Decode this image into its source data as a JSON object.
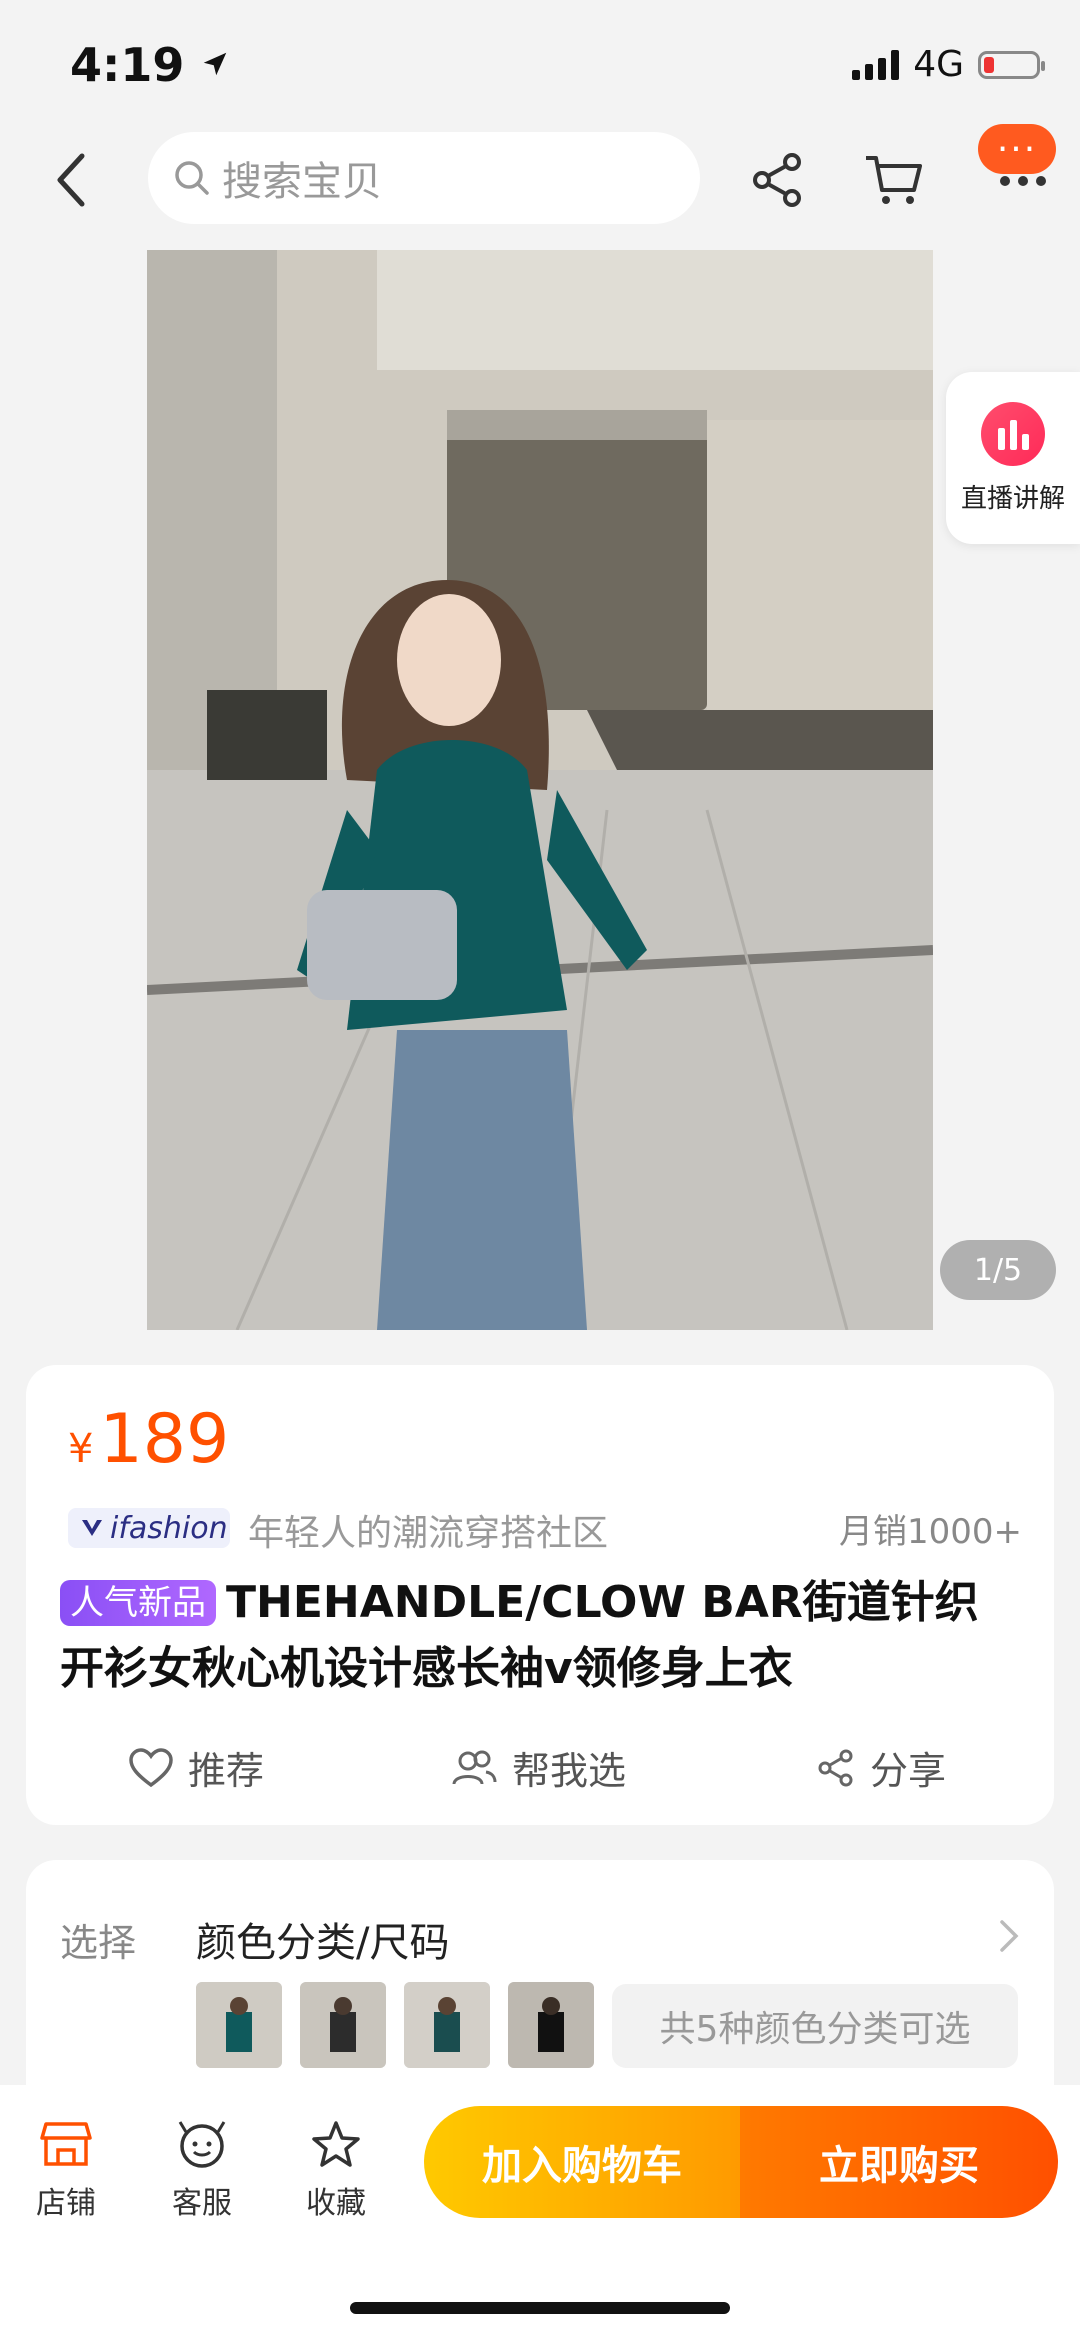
{
  "status_bar": {
    "time": "4:19",
    "network": "4G"
  },
  "nav": {
    "search_placeholder": "搜索宝贝",
    "more_badge": "···"
  },
  "live": {
    "label": "直播讲解"
  },
  "gallery": {
    "page_indicator": "1/5"
  },
  "product": {
    "currency": "¥",
    "price": "189",
    "brand_badge": "ifashion",
    "slogan": "年轻人的潮流穿搭社区",
    "monthly_sales": "月销1000+",
    "tag": "人气新品",
    "title": "THEHANDLE/CLOW BAR街道针织开衫女秋心机设计感长袖v领修身上衣",
    "actions": {
      "recommend": "推荐",
      "help_choose": "帮我选",
      "share": "分享"
    }
  },
  "sku": {
    "label": "选择",
    "value": "颜色分类/尺码",
    "options_note": "共5种颜色分类可选"
  },
  "bottom_bar": {
    "store": "店铺",
    "service": "客服",
    "favorite": "收藏",
    "add_to_cart": "加入购物车",
    "buy_now": "立即购买"
  },
  "colors": {
    "accent": "#ff5000",
    "cart_button": "#ffb300",
    "tag": "#9b5cff"
  }
}
